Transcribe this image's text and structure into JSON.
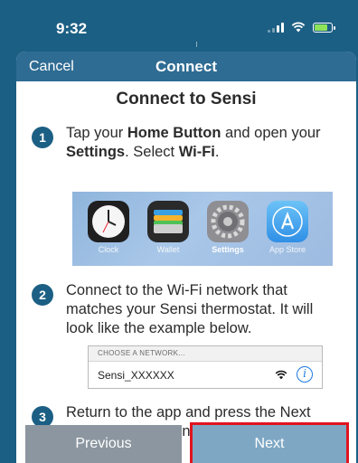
{
  "status_bar": {
    "time": "9:32",
    "battery_color": "#8ee35a"
  },
  "nav": {
    "cancel_label": "Cancel",
    "title": "Connect"
  },
  "heading": "Connect to Sensi",
  "steps": [
    {
      "number": "1",
      "text_parts": [
        "Tap your ",
        "Home Button",
        " and open your ",
        "Settings",
        ". Select ",
        "Wi-Fi",
        "."
      ]
    },
    {
      "number": "2",
      "text": "Connect to the Wi-Fi network that matches your Sensi thermostat. It will look like the example below."
    },
    {
      "number": "3",
      "text": "Return to the app and press the Next button below when finished."
    }
  ],
  "ios_apps": [
    {
      "name": "Clock",
      "icon": "clock-icon"
    },
    {
      "name": "Wallet",
      "icon": "wallet-icon"
    },
    {
      "name": "Settings",
      "icon": "settings-gear-icon"
    },
    {
      "name": "App Store",
      "icon": "app-store-icon"
    }
  ],
  "network_example": {
    "header": "CHOOSE A NETWORK...",
    "name": "Sensi_XXXXXX",
    "info_glyph": "i"
  },
  "buttons": {
    "previous_label": "Previous",
    "next_label": "Next"
  },
  "colors": {
    "header_blue": "#1c5f84",
    "nav_blue": "#2f6c93",
    "highlight_red": "#e0141e"
  }
}
